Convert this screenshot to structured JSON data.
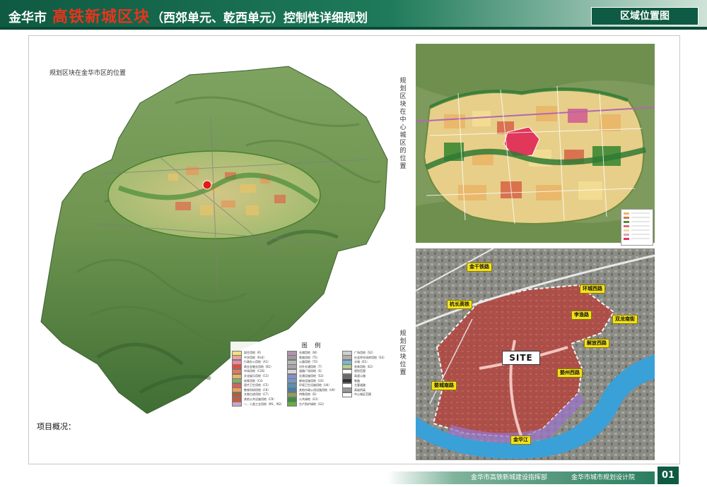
{
  "header": {
    "city": "金华市",
    "highlight": "高铁新城区块",
    "rest": "（西郊单元、乾西单元）控制性详细规划",
    "badge": "区域位置图"
  },
  "captions": {
    "main": "规划区块在金华市区的位置",
    "center": "规划区块在中心城区的位置",
    "site": "规划区块位置",
    "project": "项目概况："
  },
  "site_map": {
    "site_label": "SITE",
    "roads": [
      "金千铁路",
      "杭长高铁",
      "环城西路",
      "李渔路",
      "双龙南街",
      "解放西路",
      "婺州西路",
      "金华江",
      "婺城南路"
    ]
  },
  "legend": {
    "title": "图 例",
    "items": [
      {
        "label": "居住用地（R）",
        "color": "#f2e27a"
      },
      {
        "label": "中学用地（Rs4）",
        "color": "#e9a4a0"
      },
      {
        "label": "行政办公用地（A1）",
        "color": "#e58ca8"
      },
      {
        "label": "商业金融业用地（B1）",
        "color": "#e24d3c"
      },
      {
        "label": "市场用地（C26）",
        "color": "#e67a56"
      },
      {
        "label": "文化娱乐用地（C3）",
        "color": "#e9b36e"
      },
      {
        "label": "体育用地（C4）",
        "color": "#7fb063"
      },
      {
        "label": "医疗卫生用地（C5）",
        "color": "#d86060"
      },
      {
        "label": "教育科研用地（C6）",
        "color": "#e3a55a"
      },
      {
        "label": "文物古迹用地（C7）",
        "color": "#b45d3e"
      },
      {
        "label": "其他公共设施用地（C9）",
        "color": "#c95a3e"
      },
      {
        "label": "一、二类工业用地（M1、M2）",
        "color": "#c9a7c3"
      },
      {
        "label": "仓储用地（W）",
        "color": "#b691b0"
      },
      {
        "label": "铁路用地（T1）",
        "color": "#9c9c9c"
      },
      {
        "label": "公路用地（T2）",
        "color": "#b7b7b7"
      },
      {
        "label": "对外交通用地（T）",
        "color": "#a6a6a6"
      },
      {
        "label": "道路广场用地（S）",
        "color": "#d8d8d8"
      },
      {
        "label": "交通设施用地（S3）",
        "color": "#8c8cc6"
      },
      {
        "label": "邮电设施用地（U3）",
        "color": "#6b9cc8"
      },
      {
        "label": "环境卫生设施用地（U4）",
        "color": "#5d8fb0"
      },
      {
        "label": "其他市政公用设施用地（U9）",
        "color": "#4f7ba0"
      },
      {
        "label": "特殊用地（D）",
        "color": "#8d9f5a"
      },
      {
        "label": "公共绿地（G1）",
        "color": "#3e8e3e"
      },
      {
        "label": "生产防护绿地（G2）",
        "color": "#6aaa4c"
      },
      {
        "label": "广场用地（S2）",
        "color": "#cfcfcf"
      },
      {
        "label": "社会停车场库用地（S3）",
        "color": "#b0b0b0"
      },
      {
        "label": "水域（E1）",
        "color": "#7fb4d8"
      },
      {
        "label": "农林用地（E2）",
        "color": "#b6cf8a"
      },
      {
        "label": "规划范围",
        "color": "#ffffff"
      },
      {
        "label": "高速公路",
        "color": "#6a6a6a"
      },
      {
        "label": "铁路",
        "color": "#333333"
      },
      {
        "label": "主要道路",
        "color": "#ffffff"
      },
      {
        "label": "高架桥梁",
        "color": "#999999"
      },
      {
        "label": "中心城区范围",
        "color": "#ffffff"
      }
    ]
  },
  "footer": {
    "org1": "金华市高铁新城建设指挥部",
    "org2": "金华市城市规划设计院",
    "page": "01"
  },
  "colors": {
    "header_green": "#0f5a42",
    "title_red": "#e8341c",
    "site_red": "#b5433f",
    "river_blue": "#3aa0d8",
    "road_yellow": "#f3e21a"
  }
}
